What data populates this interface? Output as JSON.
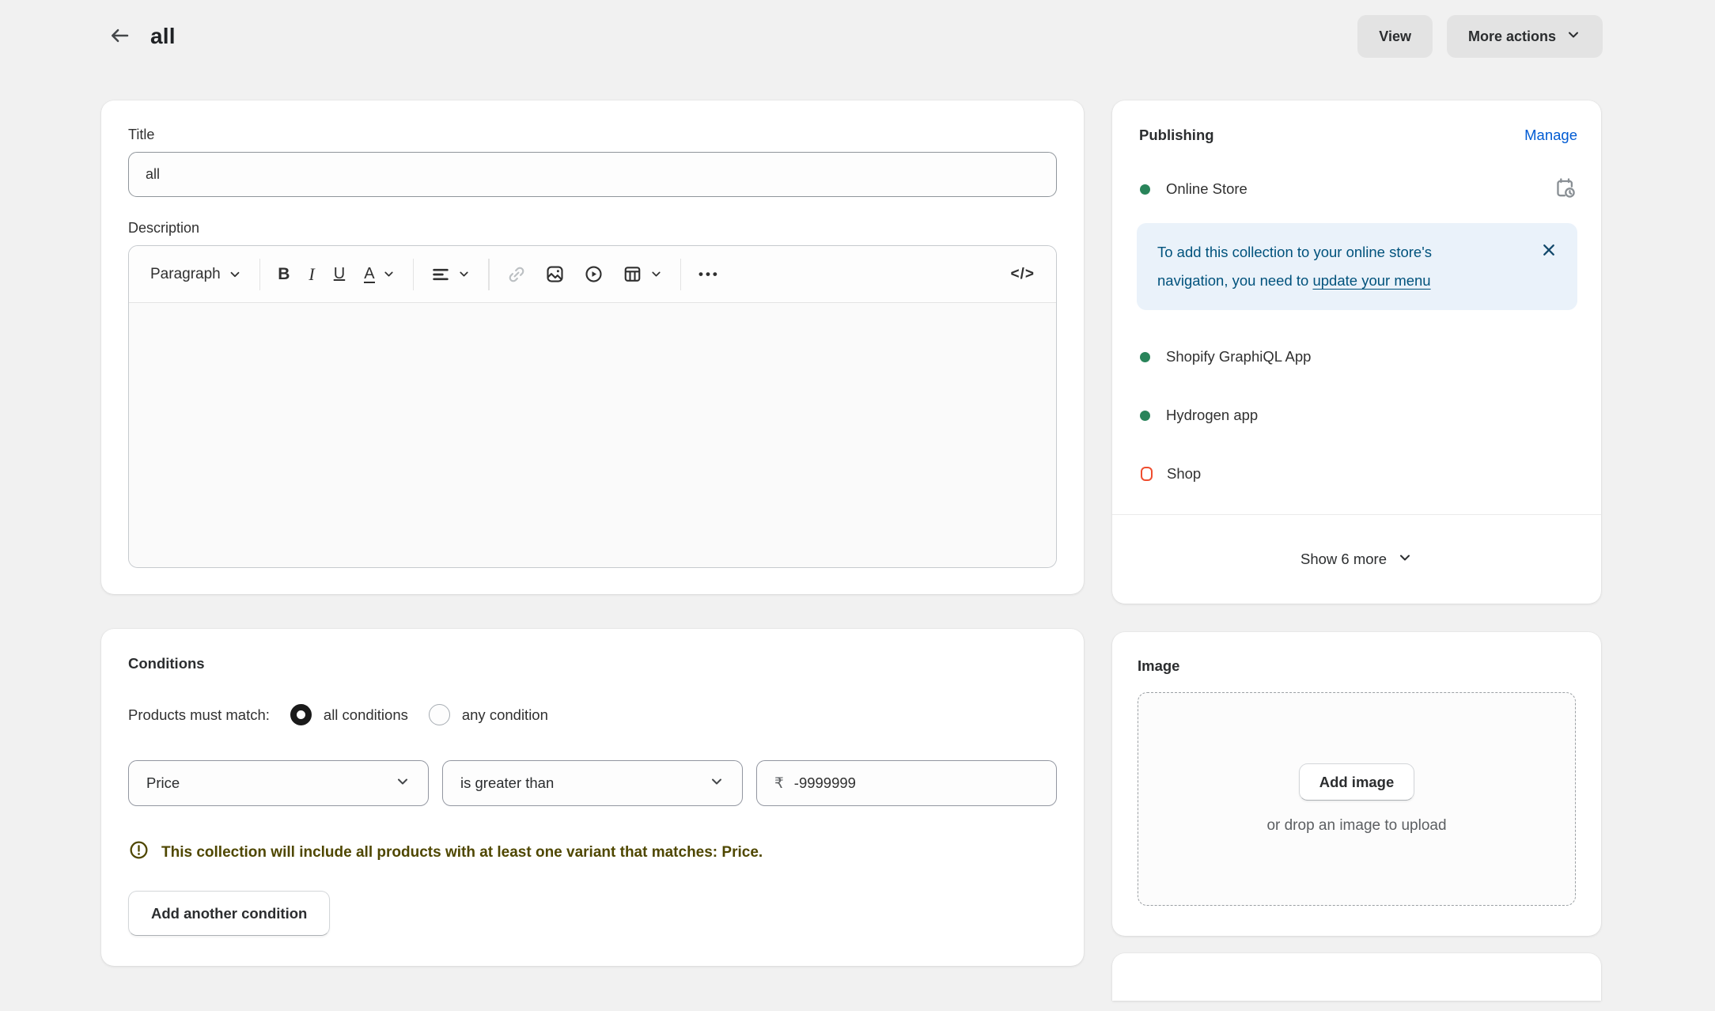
{
  "header": {
    "title": "all",
    "view_label": "View",
    "more_actions_label": "More actions"
  },
  "collection_card": {
    "title_label": "Title",
    "title_value": "all",
    "description_label": "Description",
    "editor_toolbar": {
      "paragraph_label": "Paragraph",
      "bold_label": "B",
      "italic_label": "I",
      "underline_label": "U",
      "text_color_label": "A",
      "more_label": "•••",
      "code_label": "</>"
    },
    "description_value": ""
  },
  "conditions_card": {
    "heading": "Conditions",
    "match_label": "Products must match:",
    "options": [
      {
        "label": "all conditions",
        "selected": true
      },
      {
        "label": "any condition",
        "selected": false
      }
    ],
    "condition_row": {
      "field": "Price",
      "operator": "is greater than",
      "currency_symbol": "₹",
      "value": "-9999999"
    },
    "warning_text": "This collection will include all products with at least one variant that matches: Price.",
    "add_condition_label": "Add another condition"
  },
  "publishing_card": {
    "heading": "Publishing",
    "manage_label": "Manage",
    "channels": [
      {
        "name": "Online Store",
        "status": "active"
      },
      {
        "name": "Shopify GraphiQL App",
        "status": "active"
      },
      {
        "name": "Hydrogen app",
        "status": "active"
      },
      {
        "name": "Shop",
        "status": "inactive"
      }
    ],
    "banner": {
      "text": "To add this collection to your online store's navigation, you need to",
      "link_label": "update your menu"
    },
    "show_more_label": "Show 6 more"
  },
  "image_card": {
    "heading": "Image",
    "add_image_label": "Add image",
    "drop_hint": "or drop an image to upload"
  },
  "colors": {
    "page_bg": "#F1F1F1",
    "button_gray": "#E3E3E3",
    "accent_blue": "#005BD3",
    "success_green": "#29845A",
    "critical_red": "#EF4D2F",
    "caution_text": "#4F4700",
    "banner_bg": "#EAF2FA",
    "banner_text": "#00527C"
  }
}
